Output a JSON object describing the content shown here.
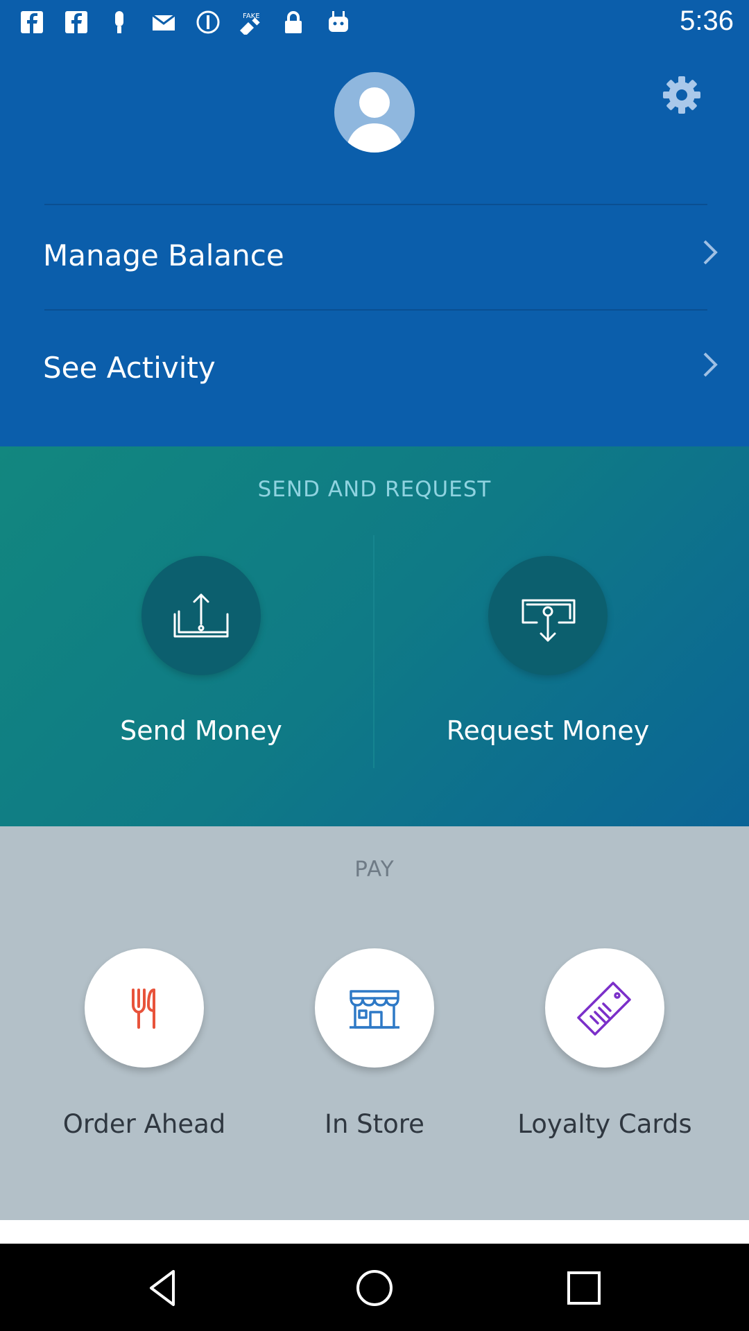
{
  "status_bar": {
    "time": "5:36",
    "icons": [
      "facebook-icon",
      "facebook-icon",
      "notification-icon",
      "mail-icon",
      "info-icon",
      "fake-gps-icon",
      "lock-icon",
      "android-icon"
    ]
  },
  "header": {
    "avatar_icon": "person-icon",
    "settings_icon": "gear-icon"
  },
  "menu": {
    "items": [
      {
        "label": "Manage Balance"
      },
      {
        "label": "See Activity"
      }
    ]
  },
  "send_request": {
    "title": "SEND AND REQUEST",
    "actions": [
      {
        "label": "Send Money",
        "icon": "send-money-icon"
      },
      {
        "label": "Request Money",
        "icon": "request-money-icon"
      }
    ]
  },
  "pay": {
    "title": "PAY",
    "actions": [
      {
        "label": "Order Ahead",
        "icon": "fork-knife-icon"
      },
      {
        "label": "In Store",
        "icon": "storefront-icon"
      },
      {
        "label": "Loyalty Cards",
        "icon": "tag-icon"
      }
    ]
  },
  "colors": {
    "primary_blue": "#0b5eab",
    "teal": "#0f7a86",
    "pay_bg": "#b3c0c8",
    "send_title": "#8fd3e0",
    "fork_red": "#e8533b",
    "store_blue": "#2e79c6",
    "tag_purple": "#7b2fc9"
  },
  "nav_bar": {
    "buttons": [
      "back-icon",
      "home-icon",
      "recents-icon"
    ]
  }
}
